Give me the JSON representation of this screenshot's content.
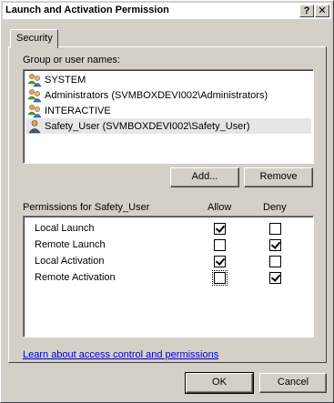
{
  "window": {
    "title": "Launch and Activation Permission",
    "help_button": "?",
    "close_button": "✕"
  },
  "tabs": [
    {
      "label": "Security",
      "selected": true
    }
  ],
  "group_section": {
    "label": "Group or user names:",
    "users": [
      {
        "name": "SYSTEM",
        "icon": "group-icon",
        "selected": false
      },
      {
        "name": "Administrators (SVMBOXDEVI002\\Administrators)",
        "icon": "group-icon",
        "selected": false
      },
      {
        "name": "INTERACTIVE",
        "icon": "group-icon",
        "selected": false
      },
      {
        "name": "Safety_User (SVMBOXDEVI002\\Safety_User)",
        "icon": "user-icon",
        "selected": true
      }
    ],
    "add_button": "Add...",
    "remove_button": "Remove"
  },
  "permissions": {
    "label": "Permissions for Safety_User",
    "allow_header": "Allow",
    "deny_header": "Deny",
    "rows": [
      {
        "name": "Local Launch",
        "allow": true,
        "deny": false
      },
      {
        "name": "Remote Launch",
        "allow": false,
        "deny": true
      },
      {
        "name": "Local Activation",
        "allow": true,
        "deny": false
      },
      {
        "name": "Remote Activation",
        "allow": false,
        "deny": true
      }
    ]
  },
  "link_text": "Learn about access control and permissions",
  "footer": {
    "ok_button": "OK",
    "cancel_button": "Cancel"
  }
}
